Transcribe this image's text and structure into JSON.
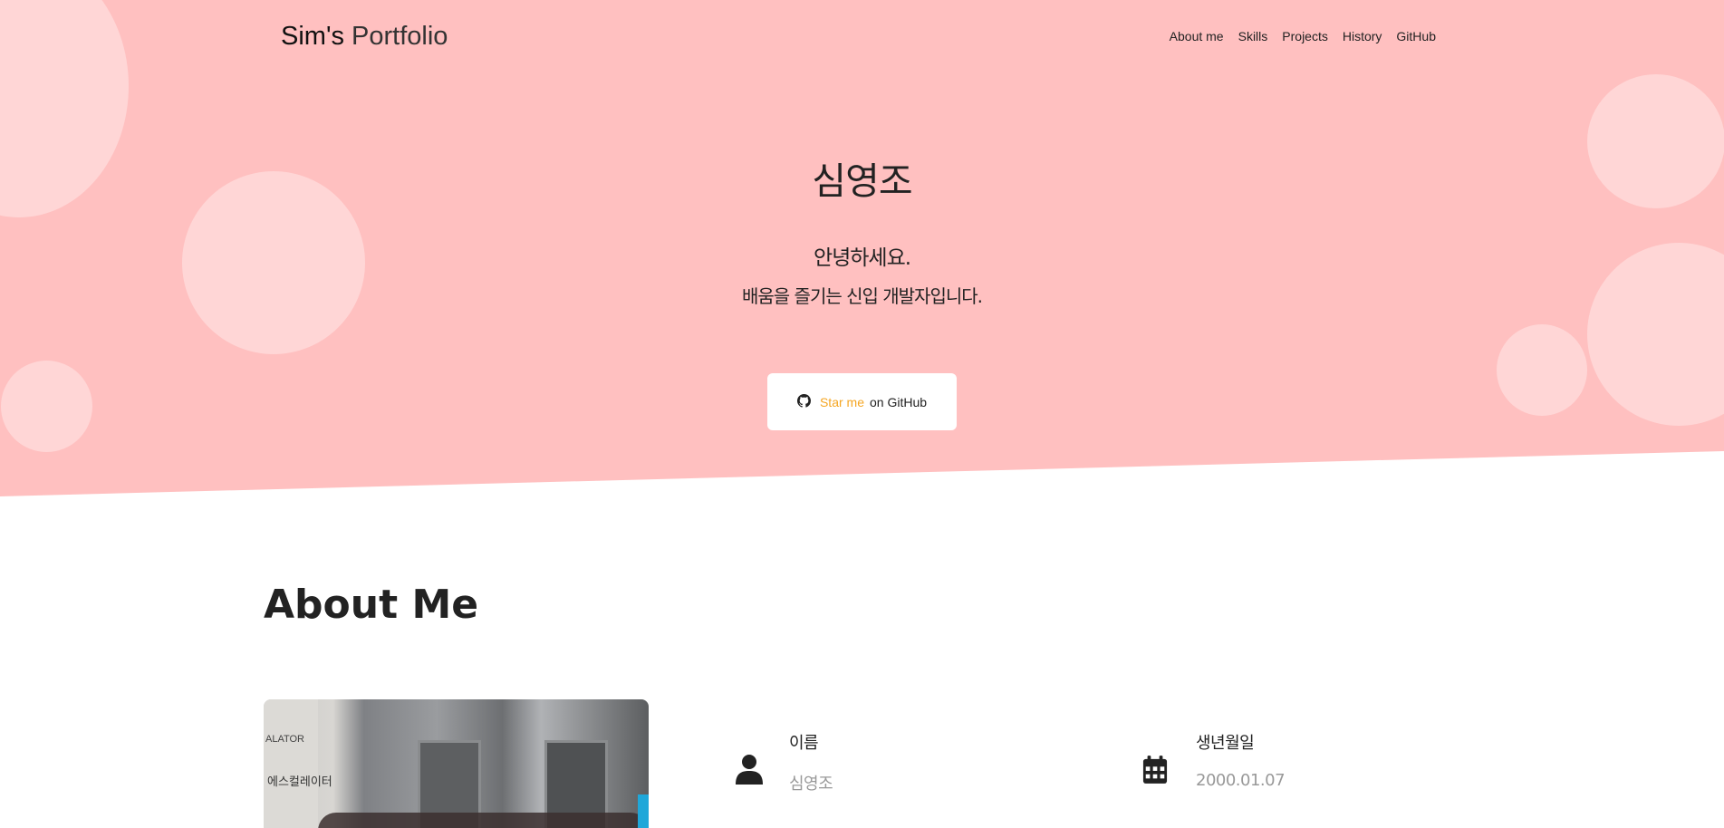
{
  "navbar": {
    "brand_main": "Sim's",
    "brand_thin": "Portfolio",
    "links": [
      "About me",
      "Skills",
      "Projects",
      "History",
      "GitHub"
    ]
  },
  "hero": {
    "name": "심영조",
    "greeting": "안녕하세요.",
    "tagline": "배움을 즐기는 신입 개발자입니다.",
    "button": {
      "icon": "github-icon",
      "star_text": "Star me",
      "rest_text": "on GitHub",
      "star_color": "#f5a623"
    },
    "background_color": "#ffc0c0"
  },
  "about": {
    "title": "About Me",
    "items": [
      {
        "icon": "user-icon",
        "label": "이름",
        "value": "심영조"
      },
      {
        "icon": "calendar-icon",
        "label": "생년월일",
        "value": "2000.01.07"
      }
    ],
    "photo_sign_text": [
      "ALATOR",
      "에스컬레이터"
    ]
  }
}
